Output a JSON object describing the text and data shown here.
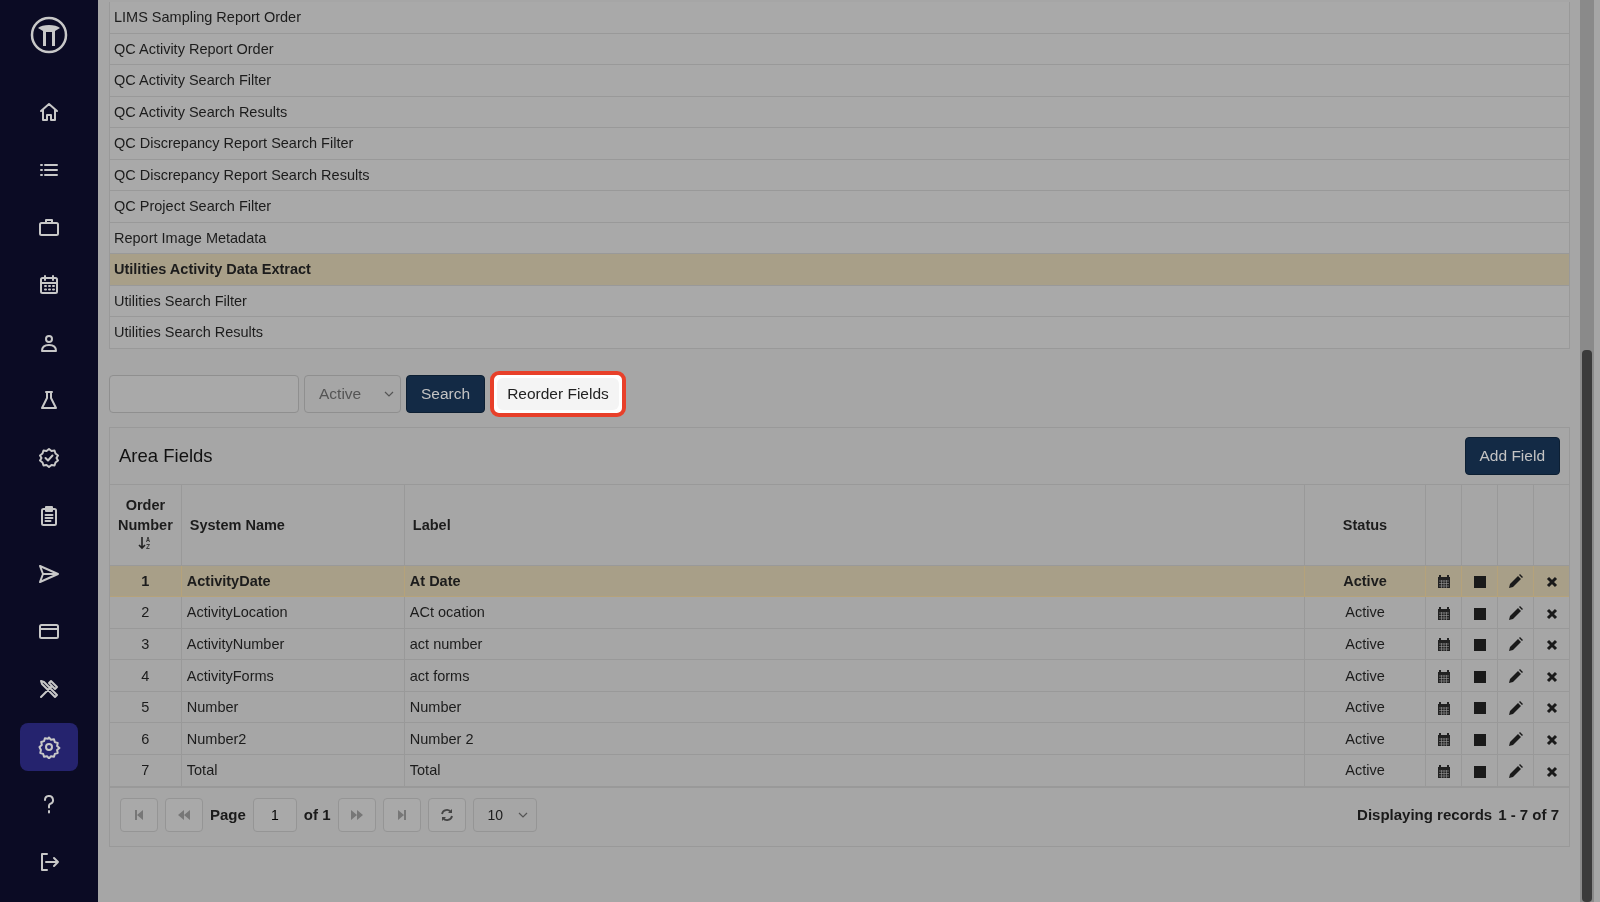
{
  "sidebar": {
    "items": [
      {
        "kind": "home",
        "selected": false
      },
      {
        "kind": "list",
        "selected": false
      },
      {
        "kind": "briefcase",
        "selected": false
      },
      {
        "kind": "calendar",
        "selected": false
      },
      {
        "kind": "worker",
        "selected": false
      },
      {
        "kind": "flask",
        "selected": false
      },
      {
        "kind": "badge",
        "selected": false
      },
      {
        "kind": "clipboard",
        "selected": false
      },
      {
        "kind": "send",
        "selected": false
      },
      {
        "kind": "card",
        "selected": false
      },
      {
        "kind": "tools",
        "selected": false
      },
      {
        "kind": "settings",
        "selected": true
      },
      {
        "kind": "help",
        "selected": false
      },
      {
        "kind": "logout",
        "selected": false
      }
    ]
  },
  "areas": [
    {
      "label": "LIMS Sampling Report Order",
      "selected": false
    },
    {
      "label": "QC Activity Report Order",
      "selected": false
    },
    {
      "label": "QC Activity Search Filter",
      "selected": false
    },
    {
      "label": "QC Activity Search Results",
      "selected": false
    },
    {
      "label": "QC Discrepancy Report Search Filter",
      "selected": false
    },
    {
      "label": "QC Discrepancy Report Search Results",
      "selected": false
    },
    {
      "label": "QC Project Search Filter",
      "selected": false
    },
    {
      "label": "Report Image Metadata",
      "selected": false
    },
    {
      "label": "Utilities Activity Data Extract",
      "selected": true
    },
    {
      "label": "Utilities Search Filter",
      "selected": false
    },
    {
      "label": "Utilities Search Results",
      "selected": false
    }
  ],
  "filter": {
    "status": "Active",
    "search_button": "Search",
    "reorder_button": "Reorder Fields",
    "reorder_highlighted": true
  },
  "panel": {
    "title": "Area Fields",
    "add_button": "Add Field",
    "columns": [
      "Order Number",
      "System Name",
      "Label",
      "Status"
    ],
    "rows": [
      {
        "order": "1",
        "system_name": "ActivityDate",
        "label": "At Date",
        "status": "Active",
        "selected": true
      },
      {
        "order": "2",
        "system_name": "ActivityLocation",
        "label": "ACt ocation",
        "status": "Active",
        "selected": false
      },
      {
        "order": "3",
        "system_name": "ActivityNumber",
        "label": "act number",
        "status": "Active",
        "selected": false
      },
      {
        "order": "4",
        "system_name": "ActivityForms",
        "label": "act forms",
        "status": "Active",
        "selected": false
      },
      {
        "order": "5",
        "system_name": "Number",
        "label": "Number",
        "status": "Active",
        "selected": false
      },
      {
        "order": "6",
        "system_name": "Number2",
        "label": "Number 2",
        "status": "Active",
        "selected": false
      },
      {
        "order": "7",
        "system_name": "Total",
        "label": "Total",
        "status": "Active",
        "selected": false
      }
    ]
  },
  "pager": {
    "page_label": "Page",
    "page": "1",
    "of_label": "of 1",
    "page_size": "10",
    "summary": "Displaying records",
    "range": "1 - 7 of 7"
  }
}
